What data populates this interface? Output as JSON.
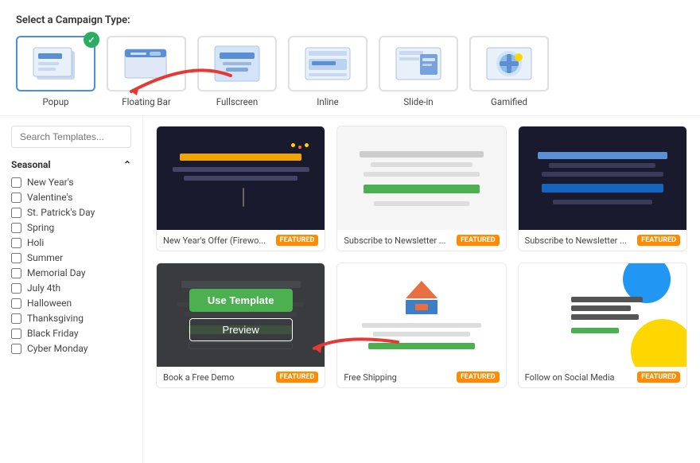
{
  "header": {
    "label": "Select a Campaign Type:"
  },
  "campaign_types": [
    {
      "id": "popup",
      "label": "Popup",
      "selected": true
    },
    {
      "id": "floating-bar",
      "label": "Floating Bar",
      "selected": false
    },
    {
      "id": "fullscreen",
      "label": "Fullscreen",
      "selected": false
    },
    {
      "id": "inline",
      "label": "Inline",
      "selected": false
    },
    {
      "id": "slide-in",
      "label": "Slide-in",
      "selected": false
    },
    {
      "id": "gamified",
      "label": "Gamified",
      "selected": false
    }
  ],
  "sidebar": {
    "search_placeholder": "Search Templates...",
    "category_label": "Seasonal",
    "items": [
      {
        "label": "New Year's",
        "checked": false
      },
      {
        "label": "Valentine's",
        "checked": false
      },
      {
        "label": "St. Patrick's Day",
        "checked": false
      },
      {
        "label": "Spring",
        "checked": false
      },
      {
        "label": "Holi",
        "checked": false
      },
      {
        "label": "Summer",
        "checked": false
      },
      {
        "label": "Memorial Day",
        "checked": false
      },
      {
        "label": "July 4th",
        "checked": false
      },
      {
        "label": "Halloween",
        "checked": false
      },
      {
        "label": "Thanksgiving",
        "checked": false
      },
      {
        "label": "Black Friday",
        "checked": false
      },
      {
        "label": "Cyber Monday",
        "checked": false
      }
    ]
  },
  "templates": [
    {
      "id": "tpl-1",
      "name": "New Year's Offer (Firewo...",
      "featured": true,
      "theme": "dark-firework"
    },
    {
      "id": "tpl-2",
      "name": "Subscribe to Newsletter ...",
      "featured": true,
      "theme": "light-newsletter"
    },
    {
      "id": "tpl-3",
      "name": "Subscribe to Newsletter ...",
      "featured": true,
      "theme": "dark-newsletter"
    },
    {
      "id": "tpl-4",
      "name": "Book a Free Demo",
      "featured": true,
      "theme": "dark-demo",
      "hovered": true
    },
    {
      "id": "tpl-5",
      "name": "Free Shipping",
      "featured": true,
      "theme": "shipping"
    },
    {
      "id": "tpl-6",
      "name": "Follow on Social Media",
      "featured": true,
      "theme": "social"
    }
  ],
  "buttons": {
    "use_template": "Use Template",
    "preview": "Preview"
  },
  "badge": {
    "label": "FEATURED"
  }
}
